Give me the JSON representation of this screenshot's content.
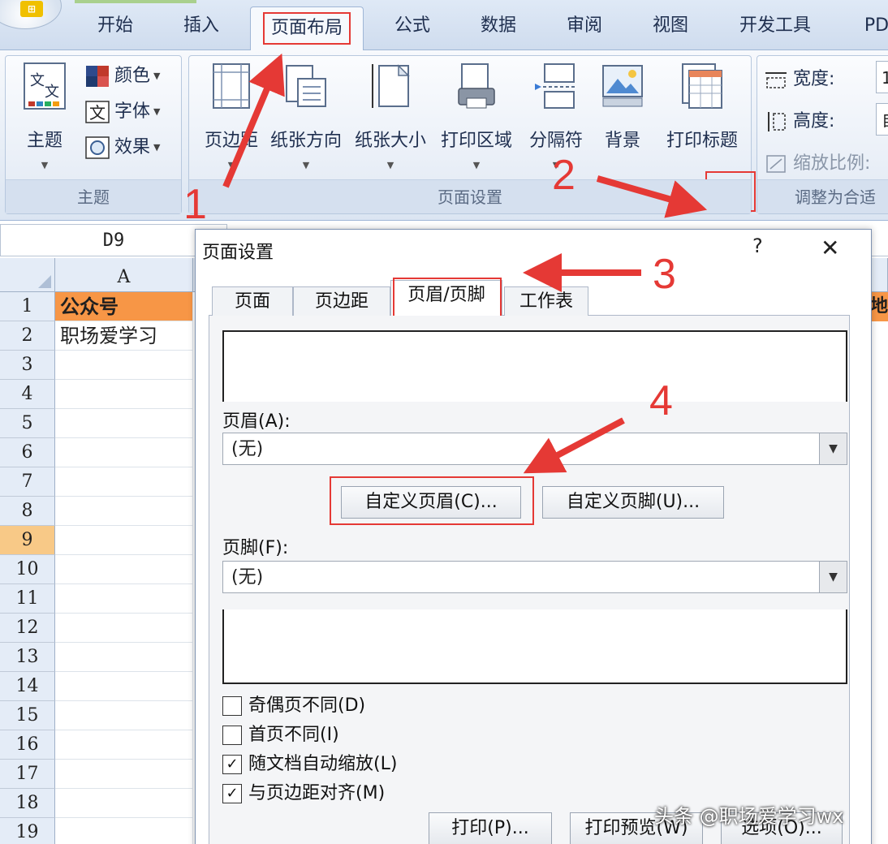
{
  "ribbon": {
    "tabs": [
      {
        "label": "开始",
        "active": false
      },
      {
        "label": "插入",
        "active": false
      },
      {
        "label": "页面布局",
        "active": true
      },
      {
        "label": "公式",
        "active": false
      },
      {
        "label": "数据",
        "active": false
      },
      {
        "label": "审阅",
        "active": false
      },
      {
        "label": "视图",
        "active": false
      },
      {
        "label": "开发工具",
        "active": false
      },
      {
        "label": "PD",
        "active": false
      }
    ],
    "theme_group": {
      "label": "主题",
      "themes_button": "主题",
      "colors": "颜色",
      "fonts": "字体",
      "effects": "效果"
    },
    "page_setup_group": {
      "label": "页面设置",
      "buttons": [
        "页边距",
        "纸张方向",
        "纸张大小",
        "打印区域",
        "分隔符",
        "背景",
        "打印标题"
      ]
    },
    "scale_group": {
      "label": "调整为合适",
      "width": "宽度:",
      "width_value": "1",
      "height": "高度:",
      "height_value": "自",
      "scale": "缩放比例:"
    }
  },
  "sheet": {
    "name_box": "D9",
    "column_a": "A",
    "row_numbers": [
      "1",
      "2",
      "3",
      "4",
      "5",
      "6",
      "7",
      "8",
      "9",
      "10",
      "11",
      "12",
      "13",
      "14",
      "15",
      "16",
      "17",
      "18",
      "19"
    ],
    "selected_row": "9",
    "cells": {
      "a1": "公众号",
      "a2": "职场爱学习",
      "right_edge_row1": "地"
    }
  },
  "dialog": {
    "title": "页面设置",
    "help": "?",
    "close": "✕",
    "tabs": [
      "页面",
      "页边距",
      "页眉/页脚",
      "工作表"
    ],
    "active_tab": "页眉/页脚",
    "header_label": "页眉(A):",
    "header_value": "(无)",
    "custom_header_button": "自定义页眉(C)...",
    "custom_footer_button": "自定义页脚(U)...",
    "footer_label": "页脚(F):",
    "footer_value": "(无)",
    "checkboxes": [
      {
        "label": "奇偶页不同(D)",
        "checked": false
      },
      {
        "label": "首页不同(I)",
        "checked": false
      },
      {
        "label": "随文档自动缩放(L)",
        "checked": true
      },
      {
        "label": "与页边距对齐(M)",
        "checked": true
      }
    ],
    "bottom_buttons": [
      "打印(P)...",
      "打印预览(W)",
      "选项(O)..."
    ]
  },
  "annotations": {
    "steps": [
      "1",
      "2",
      "3",
      "4"
    ],
    "color": "#e53935",
    "watermark": "头条 @职场爱学习wx"
  }
}
